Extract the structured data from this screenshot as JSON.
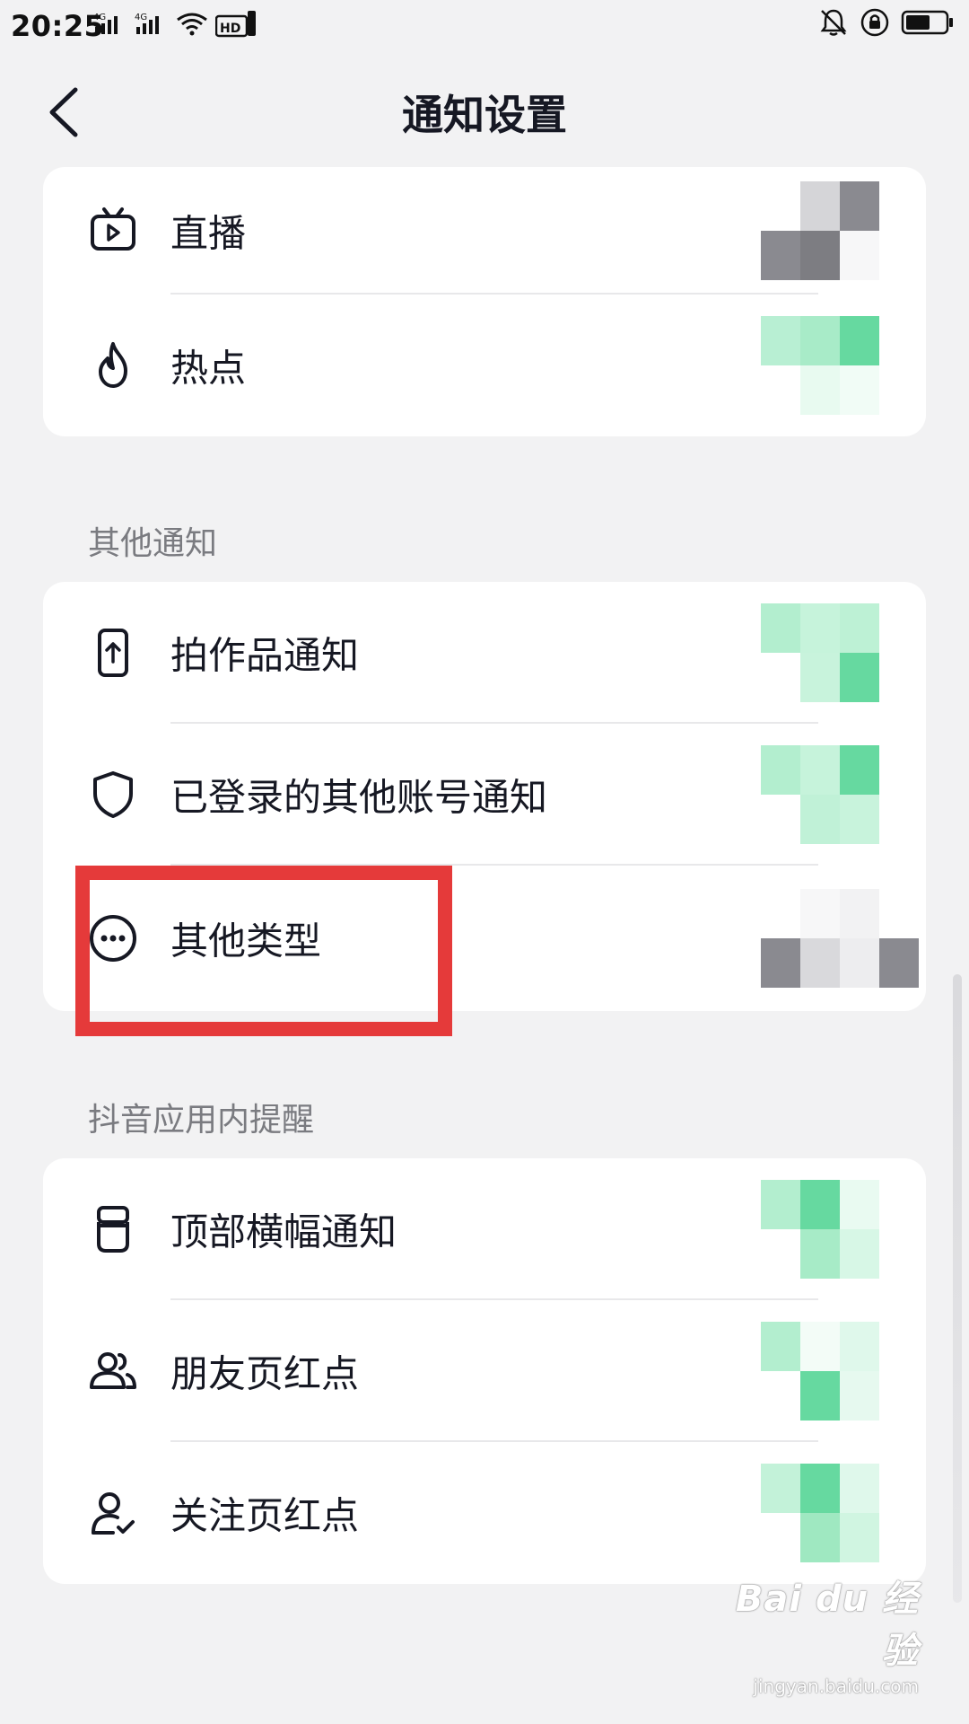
{
  "status_bar": {
    "time": "20:25"
  },
  "header": {
    "title": "通知设置"
  },
  "card_top": {
    "rows": [
      {
        "label": "直播",
        "icon": "live-tv-icon"
      },
      {
        "label": "热点",
        "icon": "flame-icon"
      }
    ]
  },
  "sections": {
    "other": {
      "title": "其他通知",
      "rows": [
        {
          "label": "拍作品通知",
          "icon": "phone-upload-icon"
        },
        {
          "label": "已登录的其他账号通知",
          "icon": "shield-icon"
        },
        {
          "label": "其他类型",
          "icon": "more-dots-icon"
        }
      ]
    },
    "in_app": {
      "title": "抖音应用内提醒",
      "rows": [
        {
          "label": "顶部横幅通知",
          "icon": "banner-cup-icon"
        },
        {
          "label": "朋友页红点",
          "icon": "friends-icon"
        },
        {
          "label": "关注页红点",
          "icon": "user-check-icon"
        }
      ]
    }
  },
  "watermark": {
    "brand": "Bai du 经验",
    "url": "jingyan.baidu.com"
  },
  "colors": {
    "highlight": "#e53a3a",
    "toggle_green": "#66d9a0",
    "toggle_off": "#8a8a90"
  }
}
